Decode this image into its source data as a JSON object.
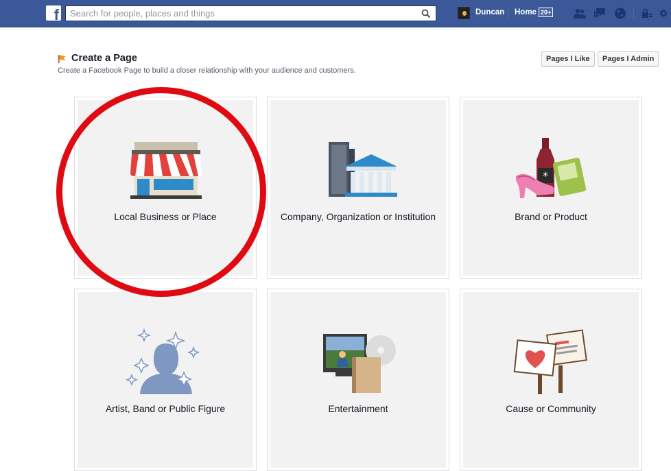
{
  "header": {
    "logo_letter": "f",
    "search": {
      "placeholder": "Search for people, places and things"
    },
    "user_name": "Duncan",
    "home_label": "Home",
    "home_count": "20+"
  },
  "page": {
    "title": "Create a Page",
    "subtitle": "Create a Facebook Page to build a closer relationship with your audience and customers.",
    "buttons": {
      "pages_i_like": "Pages I Like",
      "pages_i_admin": "Pages I Admin"
    }
  },
  "categories": [
    {
      "label": "Local Business or Place",
      "icon": "storefront-icon"
    },
    {
      "label": "Company, Organization or Institution",
      "icon": "buildings-icon"
    },
    {
      "label": "Brand or Product",
      "icon": "products-icon"
    },
    {
      "label": "Artist, Band or Public Figure",
      "icon": "star-person-icon"
    },
    {
      "label": "Entertainment",
      "icon": "media-icon"
    },
    {
      "label": "Cause or Community",
      "icon": "protest-signs-icon"
    }
  ],
  "colors": {
    "topbar": "#3b5998",
    "highlight_circle": "#e00b12",
    "tile_background": "#f2f2f2"
  }
}
